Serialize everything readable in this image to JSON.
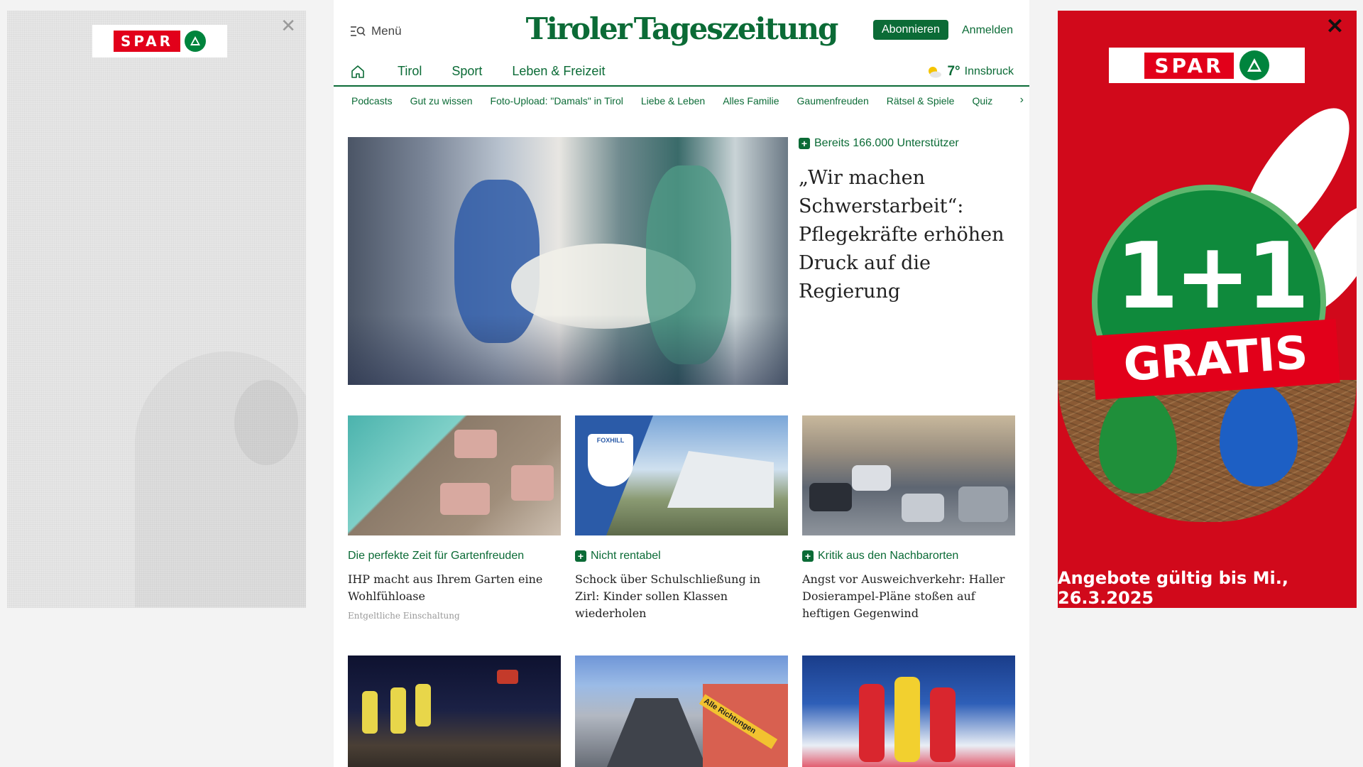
{
  "ads": {
    "left": {
      "brand": "SPAR",
      "close_label": "✕"
    },
    "right": {
      "brand": "SPAR",
      "close_label": "✕",
      "promo_number": "1+1",
      "promo_word": "GRATIS",
      "offer": "Angebote gültig bis Mi., 26.3.2025"
    }
  },
  "header": {
    "menu_label": "Menü",
    "logo_left": "Tiroler",
    "logo_right": "Tageszeitung",
    "subscribe_label": "Abonnieren",
    "login_label": "Anmelden"
  },
  "nav": {
    "items": [
      "Tirol",
      "Sport",
      "Leben & Freizeit"
    ],
    "weather": {
      "temp": "7°",
      "city": "Innsbruck"
    }
  },
  "subnav": {
    "items": [
      "Podcasts",
      "Gut zu wissen",
      "Foto-Upload: \"Damals\" in Tirol",
      "Liebe & Leben",
      "Alles Familie",
      "Gaumenfreuden",
      "Rätsel & Spiele",
      "Quiz"
    ]
  },
  "hero": {
    "kicker": "Bereits 166.000 Unterstützer",
    "title": "„Wir machen Schwerstarbeit“: Pflegekräfte erhöhen Druck auf die Regierung"
  },
  "cards": [
    {
      "kicker": "Die perfekte Zeit für Gartenfreuden",
      "title": "IHP macht aus Ihrem Garten eine Wohlfühloase",
      "note": "Entgeltliche Einschaltung"
    },
    {
      "kicker": "Nicht rentabel",
      "title": "Schock über Schulschließung in Zirl: Kinder sollen Klassen wiederholen"
    },
    {
      "kicker": "Kritik aus den Nachbarorten",
      "title": "Angst vor Ausweichverkehr: Haller Dosierampel-Pläne stoßen auf heftigen Gegenwind"
    }
  ],
  "image_texts": {
    "school_sign": "FOXHILL",
    "stairs_sign": "Alle Richtungen"
  },
  "colors": {
    "brand_green": "#0b6b36",
    "spar_red": "#e2001a"
  }
}
